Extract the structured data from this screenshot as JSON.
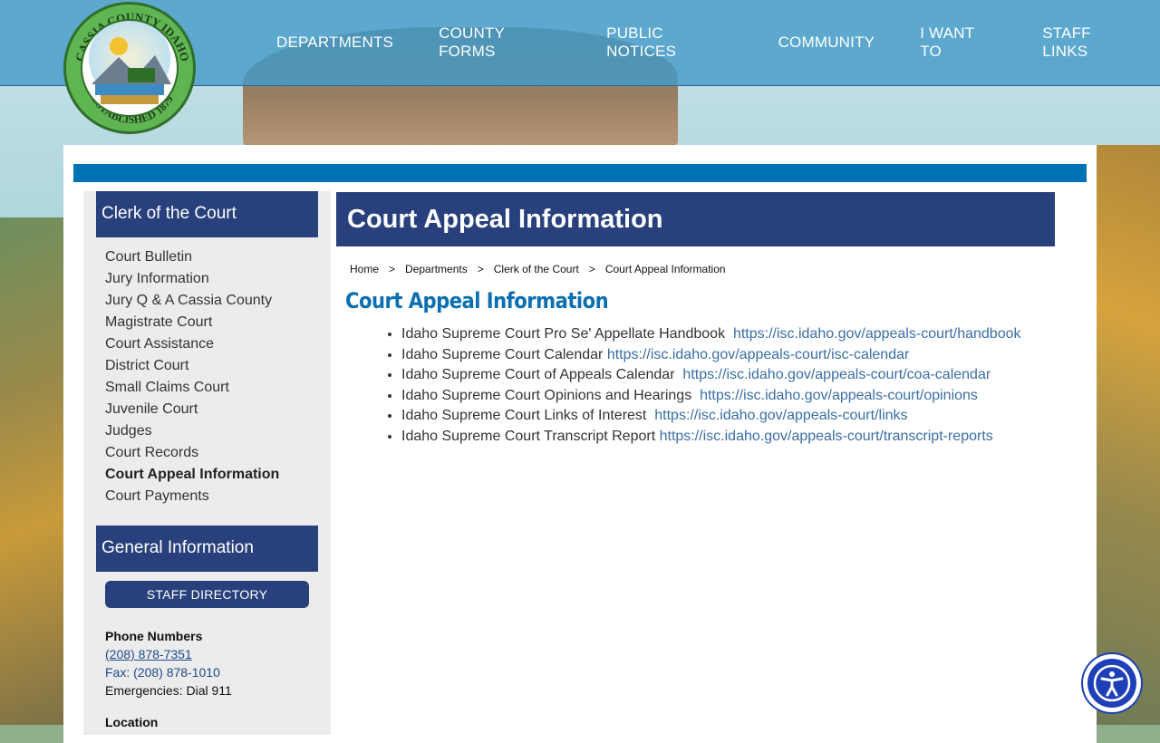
{
  "logo": {
    "top_text": "CASSIA COUNTY IDAHO",
    "bottom_text": "ESTABLISHED 1879"
  },
  "nav": [
    {
      "label": "DEPARTMENTS"
    },
    {
      "label": "COUNTY FORMS"
    },
    {
      "label": "PUBLIC NOTICES"
    },
    {
      "label": "COMMUNITY"
    },
    {
      "label": "I WANT TO"
    },
    {
      "label": "STAFF LINKS"
    }
  ],
  "sidebar": {
    "heading": "Clerk of the Court",
    "items": [
      {
        "label": "Court Bulletin"
      },
      {
        "label": "Jury Information"
      },
      {
        "label": "Jury Q & A Cassia County"
      },
      {
        "label": "Magistrate Court"
      },
      {
        "label": "Court Assistance"
      },
      {
        "label": "District Court"
      },
      {
        "label": "Small Claims Court"
      },
      {
        "label": "Juvenile Court"
      },
      {
        "label": "Judges"
      },
      {
        "label": "Court Records"
      },
      {
        "label": "Court Appeal Information"
      },
      {
        "label": "Court Payments"
      }
    ],
    "general_heading": "General Information",
    "staff_button": "STAFF DIRECTORY",
    "phone_label": "Phone Numbers",
    "phone": "(208) 878-7351",
    "fax": "Fax: (208) 878-1010",
    "emergency": "Emergencies: Dial 911",
    "location_label": "Location"
  },
  "page": {
    "title": "Court Appeal Information",
    "heading": "Court Appeal Information"
  },
  "breadcrumb": [
    {
      "label": "Home"
    },
    {
      "label": "Departments"
    },
    {
      "label": "Clerk of the Court"
    },
    {
      "label": "Court Appeal Information"
    }
  ],
  "links": [
    {
      "text": "Idaho Supreme Court Pro Se' Appellate Handbook",
      "url": "https://isc.idaho.gov/appeals-court/handbook"
    },
    {
      "text": "Idaho Supreme Court Calendar",
      "url": "https://isc.idaho.gov/appeals-court/isc-calendar"
    },
    {
      "text": "Idaho Supreme Court of Appeals Calendar",
      "url": "https://isc.idaho.gov/appeals-court/coa-calendar"
    },
    {
      "text": "Idaho Supreme Court Opinions and Hearings",
      "url": "https://isc.idaho.gov/appeals-court/opinions"
    },
    {
      "text": "Idaho Supreme Court Links of Interest",
      "url": "https://isc.idaho.gov/appeals-court/links"
    },
    {
      "text": "Idaho Supreme Court Transcript Report",
      "url": "https://isc.idaho.gov/appeals-court/transcript-reports"
    }
  ],
  "colors": {
    "header": "#469bc8",
    "navy": "#28407b",
    "accent_blue": "#0073b5",
    "link": "#3a6ea5",
    "a11y": "#1d3fb8"
  },
  "icons": {
    "accessibility": "accessibility-person-icon"
  }
}
